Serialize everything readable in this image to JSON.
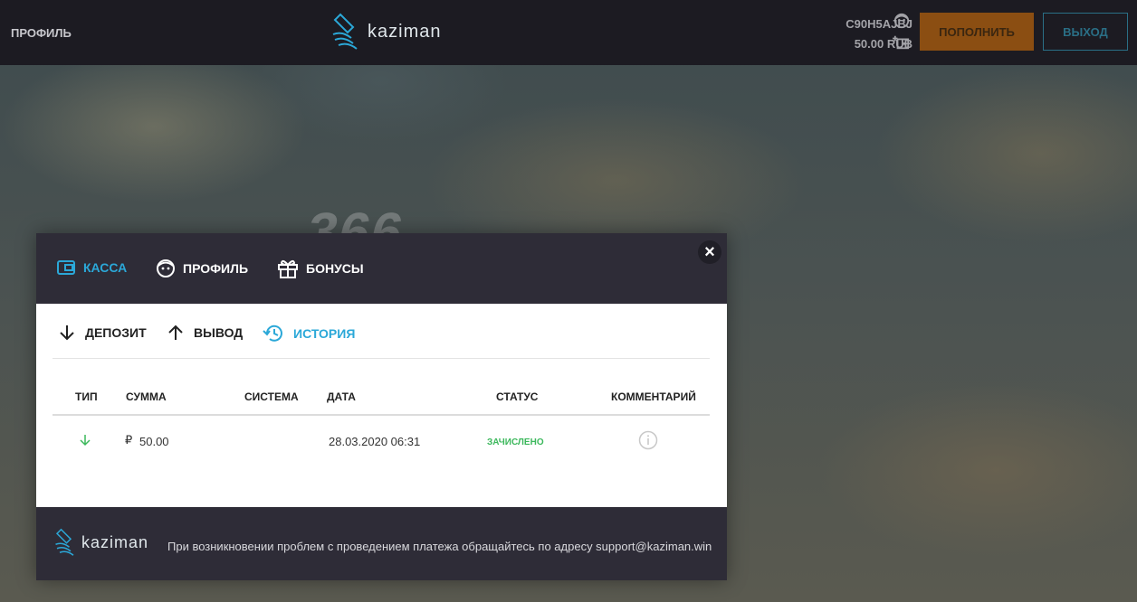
{
  "background_text": "366",
  "header": {
    "profile_link": "ПРОФИЛЬ",
    "logo_text": "kaziman",
    "user_id": "C90H5AJBJ",
    "balance": "50.00 RUB",
    "deposit_button": "ПОПОЛНИТЬ",
    "exit_button": "ВЫХОД"
  },
  "modal": {
    "tabs": [
      {
        "label": "КАССА",
        "icon": "wallet-icon",
        "active": true
      },
      {
        "label": "ПРОФИЛЬ",
        "icon": "face-icon",
        "active": false
      },
      {
        "label": "БОНУСЫ",
        "icon": "gift-icon",
        "active": false
      }
    ],
    "close_symbol": "×",
    "sub_tabs": [
      {
        "label": "ДЕПОЗИТ",
        "icon": "arrow-down-icon",
        "active": false
      },
      {
        "label": "ВЫВОД",
        "icon": "arrow-up-icon",
        "active": false
      },
      {
        "label": "ИСТОРИЯ",
        "icon": "history-icon",
        "active": true
      }
    ],
    "table": {
      "columns": [
        "ТИП",
        "СУММА",
        "СИСТЕМА",
        "ДАТА",
        "СТАТУС",
        "КОММЕНТАРИЙ"
      ],
      "rows": [
        {
          "type_icon": "arrow-down-icon",
          "currency": "₽",
          "amount": "50.00",
          "system": "",
          "date": "28.03.2020 06:31",
          "status": "ЗАЧИСЛЕНО",
          "comment_icon": "info-icon"
        }
      ]
    },
    "footer": {
      "logo_text": "kaziman",
      "note": "При возникновении проблем с проведением платежа обращайтесь по адресу support@kaziman.win"
    }
  },
  "colors": {
    "accent": "#2ba8d8",
    "deposit_button_bg": "#8b4e12",
    "status_success": "#3cb85c",
    "panel_dark": "#2e2c37",
    "topbar": "#1c1b22"
  }
}
